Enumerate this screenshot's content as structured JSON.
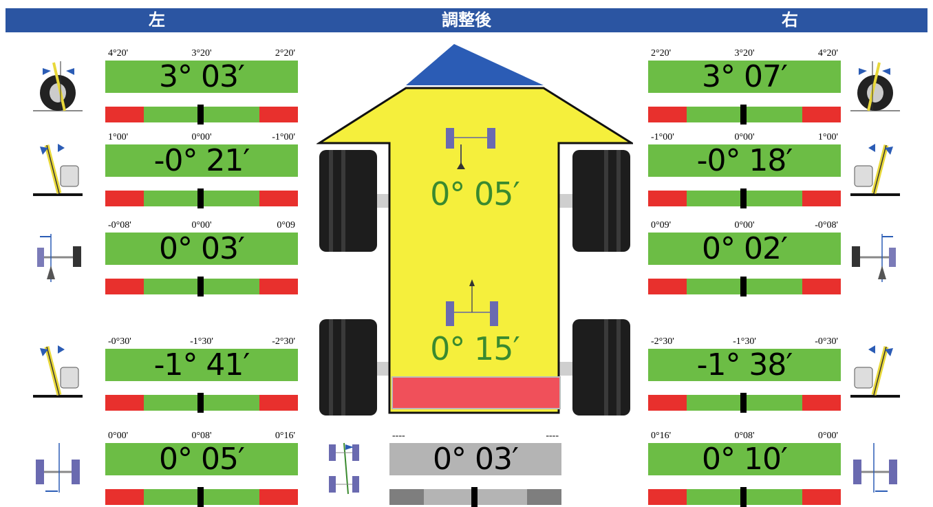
{
  "header": {
    "left_title": "左",
    "center_title": "調整後",
    "right_title": "右"
  },
  "icons": {
    "camber_front": "wheel-camber-icon",
    "caster": "caster-kingpin-icon",
    "toe": "toe-axle-icon",
    "thrust": "thrust-angle-icon"
  },
  "colors": {
    "header": "#2b55a2",
    "in_spec": "#6cbd45",
    "out_of_spec": "#e8302d",
    "neutral": "#b4b4b4",
    "arrow": "#f5ef3c",
    "arrow_tip": "#2b5cb5"
  },
  "left": {
    "row1": {
      "t0": "4°20'",
      "t1": "3°20'",
      "t2": "2°20'",
      "value": "3° 03′"
    },
    "row2": {
      "t0": "1°00'",
      "t1": "0°00'",
      "t2": "-1°00'",
      "value": "-0° 21′"
    },
    "row3": {
      "t0": "-0°08'",
      "t1": "0°00'",
      "t2": "0°09",
      "value": "0° 03′"
    },
    "row4": {
      "t0": "-0°30'",
      "t1": "-1°30'",
      "t2": "-2°30'",
      "value": "-1° 41′"
    },
    "row5": {
      "t0": "0°00'",
      "t1": "0°08'",
      "t2": "0°16'",
      "value": "0° 05′"
    }
  },
  "right": {
    "row1": {
      "t0": "2°20'",
      "t1": "3°20'",
      "t2": "4°20'",
      "value": "3° 07′"
    },
    "row2": {
      "t0": "-1°00'",
      "t1": "0°00'",
      "t2": "1°00'",
      "value": "-0° 18′"
    },
    "row3": {
      "t0": "0°09'",
      "t1": "0°00'",
      "t2": "-0°08'",
      "value": "0° 02′"
    },
    "row4": {
      "t0": "-2°30'",
      "t1": "-1°30'",
      "t2": "-0°30'",
      "value": "-1° 38′"
    },
    "row5": {
      "t0": "0°16'",
      "t1": "0°08'",
      "t2": "0°00'",
      "value": "0° 10′"
    }
  },
  "center": {
    "front_total": "0° 05′",
    "rear_total": "0° 15′",
    "thrust": {
      "t0": "----",
      "t2": "----",
      "value": "0° 03′"
    }
  }
}
